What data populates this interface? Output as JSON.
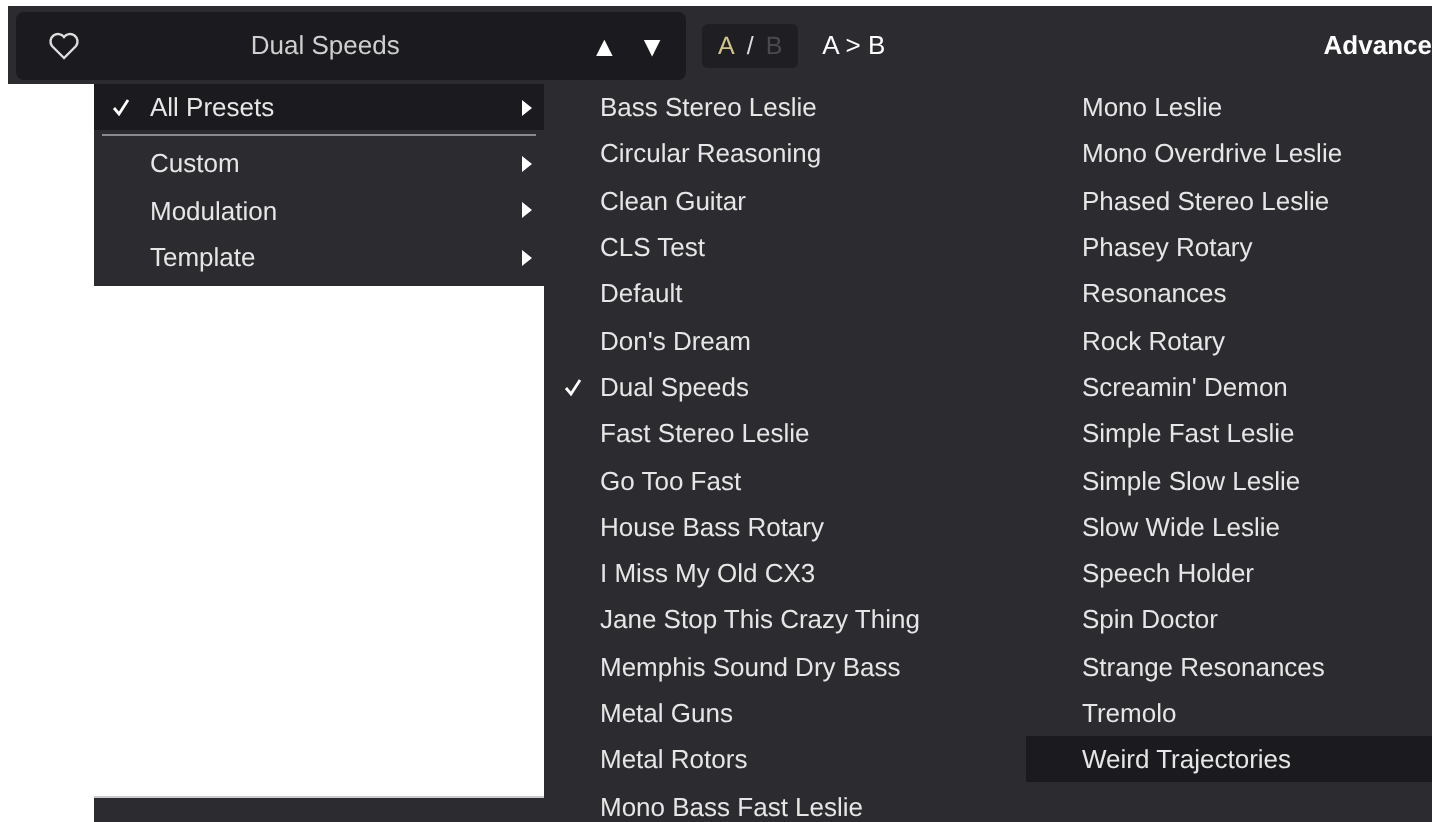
{
  "preset_bar": {
    "favorite": false,
    "name": "Dual Speeds",
    "prev": "▲",
    "next": "▼",
    "ab": {
      "a": "A",
      "separator": "/",
      "b": "B",
      "a_selected": true
    },
    "copy": "A > B",
    "advanced": "Advance"
  },
  "categories": [
    {
      "label": "All Presets",
      "checked": true,
      "selected": true
    },
    {
      "label": "Custom",
      "checked": false,
      "selected": false
    },
    {
      "label": "Modulation",
      "checked": false,
      "selected": false
    },
    {
      "label": "Template",
      "checked": false,
      "selected": false
    }
  ],
  "preset_columns": [
    [
      {
        "label": "Bass Stereo Leslie",
        "checked": false,
        "selected": false
      },
      {
        "label": "Circular Reasoning",
        "checked": false,
        "selected": false
      },
      {
        "label": "Clean Guitar",
        "checked": false,
        "selected": false
      },
      {
        "label": "CLS Test",
        "checked": false,
        "selected": false
      },
      {
        "label": "Default",
        "checked": false,
        "selected": false
      },
      {
        "label": "Don's Dream",
        "checked": false,
        "selected": false
      },
      {
        "label": "Dual Speeds",
        "checked": true,
        "selected": false
      },
      {
        "label": "Fast Stereo Leslie",
        "checked": false,
        "selected": false
      },
      {
        "label": "Go Too Fast",
        "checked": false,
        "selected": false
      },
      {
        "label": "House Bass Rotary",
        "checked": false,
        "selected": false
      },
      {
        "label": "I Miss My Old CX3",
        "checked": false,
        "selected": false
      },
      {
        "label": "Jane Stop This Crazy Thing",
        "checked": false,
        "selected": false
      },
      {
        "label": "Memphis Sound Dry Bass",
        "checked": false,
        "selected": false
      },
      {
        "label": "Metal Guns",
        "checked": false,
        "selected": false
      },
      {
        "label": "Metal Rotors",
        "checked": false,
        "selected": false
      },
      {
        "label": "Mono Bass Fast Leslie",
        "checked": false,
        "selected": false
      }
    ],
    [
      {
        "label": "Mono Leslie",
        "checked": false,
        "selected": false
      },
      {
        "label": "Mono Overdrive Leslie",
        "checked": false,
        "selected": false
      },
      {
        "label": "Phased Stereo Leslie",
        "checked": false,
        "selected": false
      },
      {
        "label": "Phasey Rotary",
        "checked": false,
        "selected": false
      },
      {
        "label": "Resonances",
        "checked": false,
        "selected": false
      },
      {
        "label": "Rock Rotary",
        "checked": false,
        "selected": false
      },
      {
        "label": "Screamin' Demon",
        "checked": false,
        "selected": false
      },
      {
        "label": "Simple Fast Leslie",
        "checked": false,
        "selected": false
      },
      {
        "label": "Simple Slow Leslie",
        "checked": false,
        "selected": false
      },
      {
        "label": "Slow Wide Leslie",
        "checked": false,
        "selected": false
      },
      {
        "label": "Speech Holder",
        "checked": false,
        "selected": false
      },
      {
        "label": "Spin Doctor",
        "checked": false,
        "selected": false
      },
      {
        "label": "Strange Resonances",
        "checked": false,
        "selected": false
      },
      {
        "label": "Tremolo",
        "checked": false,
        "selected": false
      },
      {
        "label": "Weird Trajectories",
        "checked": false,
        "selected": true
      }
    ]
  ]
}
